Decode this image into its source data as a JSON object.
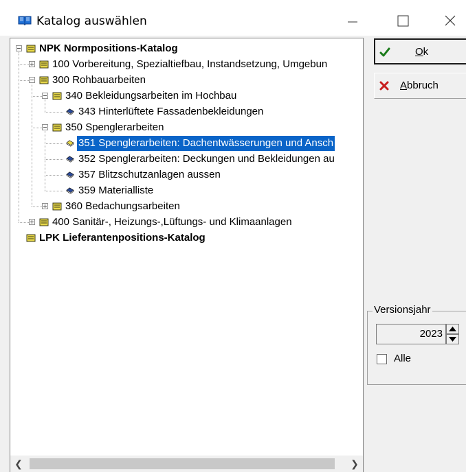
{
  "window": {
    "title": "Katalog auswählen",
    "icons": {
      "app": "open-book-icon",
      "minimize": "minimize-icon",
      "maximize": "maximize-icon",
      "close": "close-icon"
    }
  },
  "tree": {
    "items": [
      {
        "label": "NPK Normpositions-Katalog",
        "expander": "minus",
        "icon": "catalog-book-icon",
        "bold": true
      },
      {
        "label": "100 Vorbereitung, Spezialtiefbau, Instandsetzung, Umgebun",
        "expander": "plus",
        "icon": "catalog-book-icon"
      },
      {
        "label": "300 Rohbauarbeiten",
        "expander": "minus",
        "icon": "catalog-book-icon"
      },
      {
        "label": "340 Bekleidungsarbeiten im Hochbau",
        "expander": "minus",
        "icon": "catalog-book-icon"
      },
      {
        "label": "343 Hinterlüftete Fassadenbekleidungen",
        "expander": "none",
        "icon": "chapter-leaf-icon"
      },
      {
        "label": "350 Spenglerarbeiten",
        "expander": "minus",
        "icon": "catalog-book-icon"
      },
      {
        "label": "351 Spenglerarbeiten: Dachentwässerungen und Ansch",
        "expander": "none",
        "icon": "chapter-leaf-icon",
        "selected": true
      },
      {
        "label": "352 Spenglerarbeiten: Deckungen und Bekleidungen au",
        "expander": "none",
        "icon": "chapter-leaf-icon"
      },
      {
        "label": "357 Blitzschutzanlagen aussen",
        "expander": "none",
        "icon": "chapter-leaf-icon"
      },
      {
        "label": "359 Materialliste",
        "expander": "none",
        "icon": "chapter-leaf-icon"
      },
      {
        "label": "360 Bedachungsarbeiten",
        "expander": "plus",
        "icon": "catalog-book-icon"
      },
      {
        "label": "400 Sanitär-, Heizungs-,Lüftungs- und Klimaanlagen",
        "expander": "plus",
        "icon": "catalog-book-icon"
      },
      {
        "label": "LPK Lieferantenpositions-Katalog",
        "expander": "none",
        "icon": "catalog-book-icon",
        "bold": true
      }
    ]
  },
  "buttons": {
    "ok": {
      "label_prefix": "",
      "label_underlined": "O",
      "label_rest": "k",
      "icon": "checkmark-icon",
      "icon_color": "#1a7a1a"
    },
    "cancel": {
      "label_prefix": "",
      "label_underlined": "A",
      "label_rest": "bbruch",
      "icon": "cross-icon",
      "icon_color": "#c81e1e"
    }
  },
  "version_group": {
    "legend": "Versionsjahr",
    "year_value": "2023",
    "all_checkbox_label": "Alle",
    "all_checked": false
  },
  "colors": {
    "selection": "#0a64c8",
    "book_fill": "#e8d84a",
    "leaf_fill": "#2a4a9a"
  }
}
